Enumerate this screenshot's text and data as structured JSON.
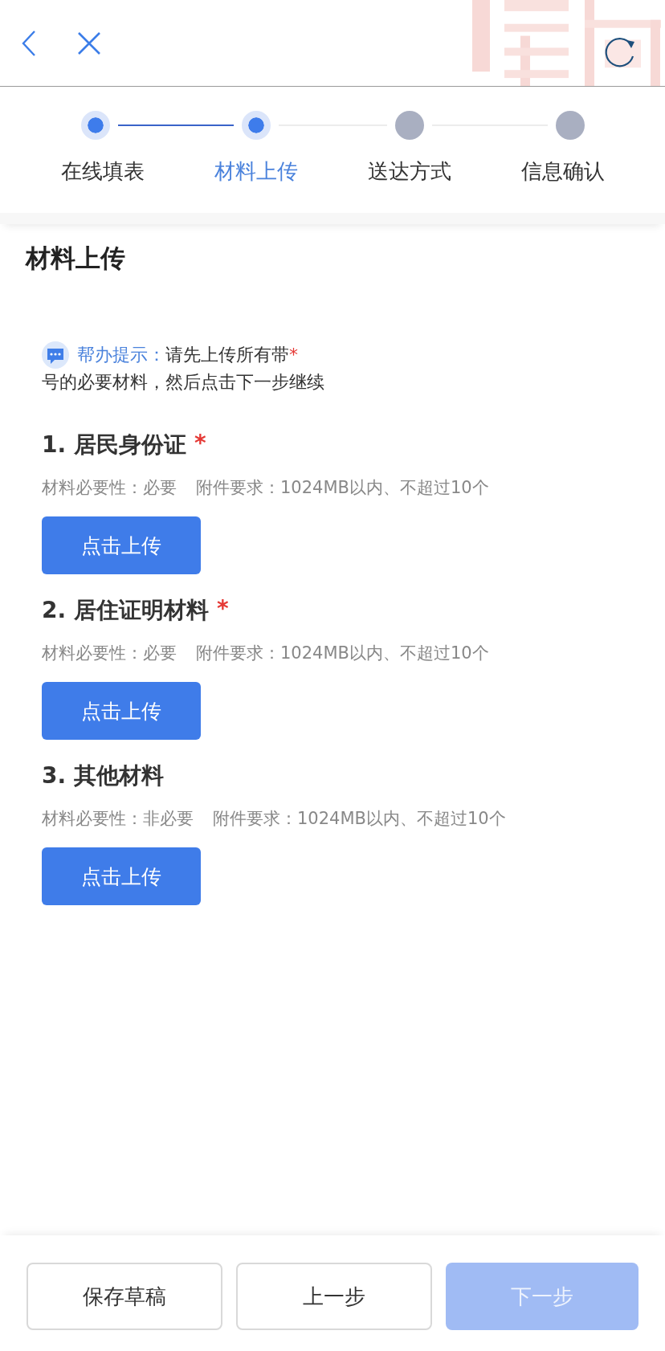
{
  "steps": [
    {
      "label": "在线填表",
      "reached": true,
      "selected": false
    },
    {
      "label": "材料上传",
      "reached": true,
      "selected": true
    },
    {
      "label": "送达方式",
      "reached": false,
      "selected": false
    },
    {
      "label": "信息确认",
      "reached": false,
      "selected": false
    }
  ],
  "title": "材料上传",
  "hint": {
    "label": "帮办提示：",
    "text_before": "请先上传所有带",
    "mark": "*",
    "text_after": "号的必要材料，然后点击下一步继续"
  },
  "materials": [
    {
      "name": "1. 居民身份证",
      "required_mark": "*",
      "necessity_label": "材料必要性：",
      "necessity": "必要",
      "attachment": "附件要求：1024MB以内、不超过10个",
      "button": "点击上传"
    },
    {
      "name": "2. 居住证明材料",
      "required_mark": "*",
      "necessity_label": "材料必要性：",
      "necessity": "必要",
      "attachment": "附件要求：1024MB以内、不超过10个",
      "button": "点击上传"
    },
    {
      "name": "3. 其他材料",
      "necessity_label": "材料必要性：",
      "necessity": "非必要",
      "attachment": "附件要求：1024MB以内、不超过10个",
      "button": "点击上传"
    }
  ],
  "footer": [
    {
      "label": "保存草稿",
      "kind": "outline",
      "disabled": false
    },
    {
      "label": "上一步",
      "kind": "outline",
      "disabled": false
    },
    {
      "label": "下一步",
      "kind": "primary",
      "disabled": true
    }
  ]
}
